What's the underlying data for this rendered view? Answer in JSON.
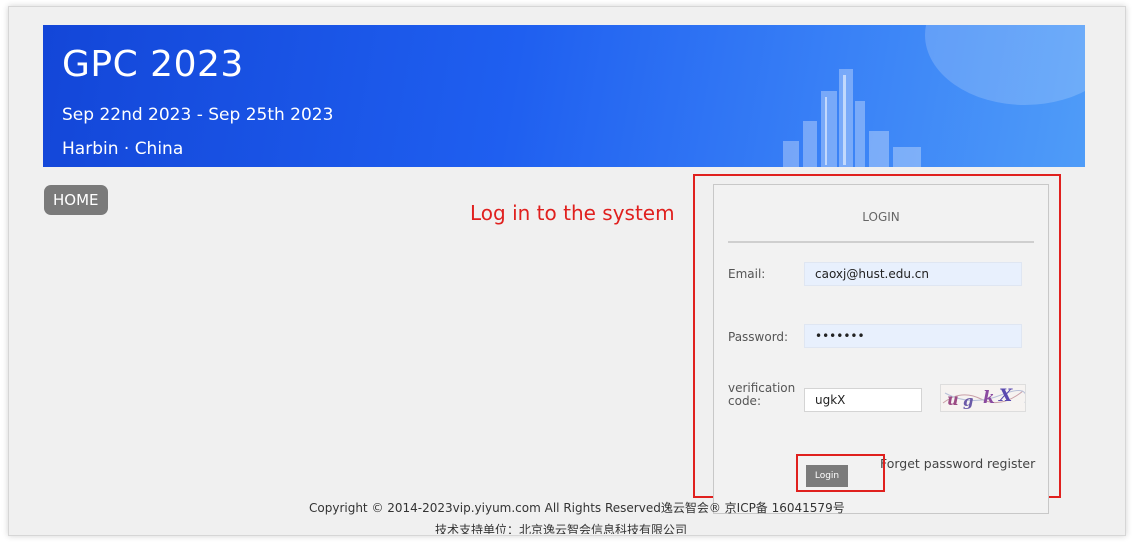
{
  "banner": {
    "title": "GPC 2023",
    "dates": "Sep 22nd 2023 - Sep 25th 2023",
    "location": "Harbin · China"
  },
  "nav": {
    "home_label": "HOME"
  },
  "annotation": {
    "text": "Log in to the system",
    "color": "#e0201e"
  },
  "login": {
    "heading": "LOGIN",
    "email_label": "Email:",
    "email_value": "caoxj@hust.edu.cn",
    "password_label": "Password:",
    "password_value": "•••••••",
    "verification_label_line1": "verification",
    "verification_label_line2": "code:",
    "verification_value": "ugkX",
    "captcha_text": "ugkX",
    "login_button": "Login",
    "forgot_link": "Forget password",
    "register_link": "register"
  },
  "footer": {
    "copyright": "Copyright © 2014-2023vip.yiyum.com All Rights Reserved逸云智会® 京ICP备 16041579号",
    "support": "技术支持单位：北京逸云智会信息科技有限公司"
  },
  "colors": {
    "banner": "#1f5ff0",
    "accent_red": "#e0201e",
    "button_gray": "#7b7b7b"
  }
}
